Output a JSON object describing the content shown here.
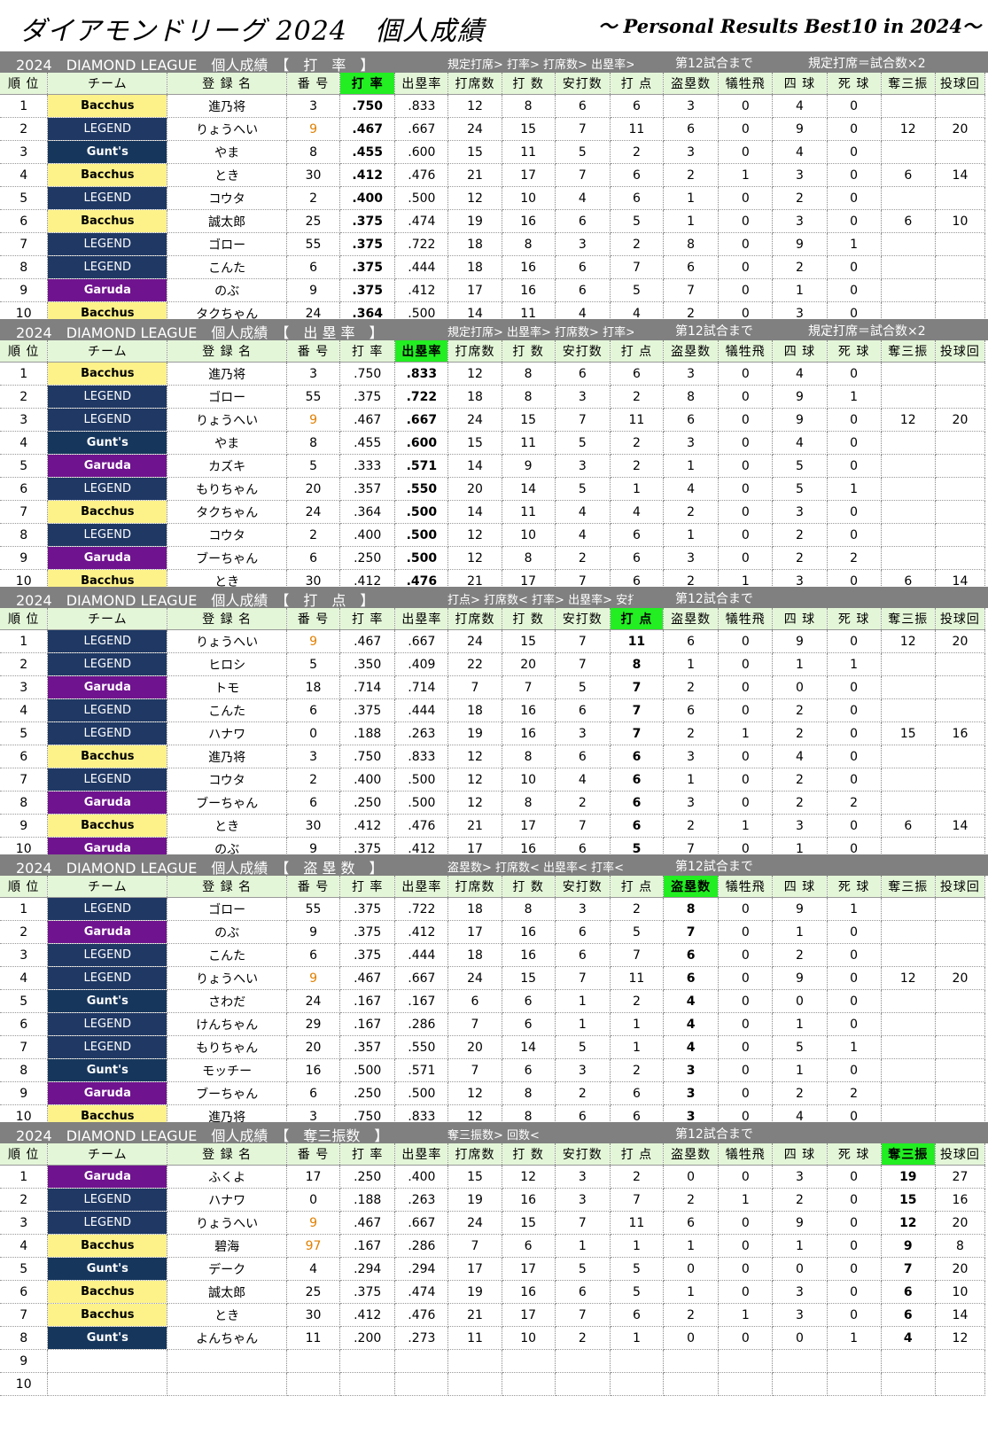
{
  "title": "ダイアモンドリーグ 2024　個人成績",
  "subtitle": "～ Personal Results Best10 in 2024～",
  "columns": [
    "順 位",
    "チーム",
    "登 録 名",
    "番 号",
    "打 率",
    "出塁率",
    "打席数",
    "打 数",
    "安打数",
    "打 点",
    "盗塁数",
    "犠牲飛",
    "四 球",
    "死 球",
    "奪三振",
    "投球回"
  ],
  "teams": {
    "B": {
      "name": "Bacchus",
      "color": "#fdf28a"
    },
    "L": {
      "name": "LEGEND",
      "color": "#1f3864"
    },
    "G": {
      "name": "Gunt's",
      "color": "#16365c"
    },
    "R": {
      "name": "Garuda",
      "color": "#70138f"
    }
  },
  "sections": [
    {
      "name": "2024　DIAMOND LEAGUE　個人成績　【　打　率　】",
      "criteria": "規定打席> 打率> 打席数> 出塁率> 打",
      "upto": "第12試合まで",
      "rule": "規定打席＝試合数×2",
      "sorted_col": 4,
      "rows": [
        [
          "1",
          "B",
          "進乃将",
          "3",
          ".750",
          ".833",
          "12",
          "8",
          "6",
          "6",
          "3",
          "0",
          "4",
          "0",
          "",
          ""
        ],
        [
          "2",
          "L",
          "りょうへい",
          "9",
          ".467",
          ".667",
          "24",
          "15",
          "7",
          "11",
          "6",
          "0",
          "9",
          "0",
          "12",
          "20"
        ],
        [
          "3",
          "G",
          "やま",
          "8",
          ".455",
          ".600",
          "15",
          "11",
          "5",
          "2",
          "3",
          "0",
          "4",
          "0",
          "",
          ""
        ],
        [
          "4",
          "B",
          "とき",
          "30",
          ".412",
          ".476",
          "21",
          "17",
          "7",
          "6",
          "2",
          "1",
          "3",
          "0",
          "6",
          "14"
        ],
        [
          "5",
          "L",
          "コウタ",
          "2",
          ".400",
          ".500",
          "12",
          "10",
          "4",
          "6",
          "1",
          "0",
          "2",
          "0",
          "",
          ""
        ],
        [
          "6",
          "B",
          "誠太郎",
          "25",
          ".375",
          ".474",
          "19",
          "16",
          "6",
          "5",
          "1",
          "0",
          "3",
          "0",
          "6",
          "10"
        ],
        [
          "7",
          "L",
          "ゴロー",
          "55",
          ".375",
          ".722",
          "18",
          "8",
          "3",
          "2",
          "8",
          "0",
          "9",
          "1",
          "",
          ""
        ],
        [
          "8",
          "L",
          "こんた",
          "6",
          ".375",
          ".444",
          "18",
          "16",
          "6",
          "7",
          "6",
          "0",
          "2",
          "0",
          "",
          ""
        ],
        [
          "9",
          "R",
          "のぶ",
          "9",
          ".375",
          ".412",
          "17",
          "16",
          "6",
          "5",
          "7",
          "0",
          "1",
          "0",
          "",
          ""
        ],
        [
          "10",
          "B",
          "タクちゃん",
          "24",
          ".364",
          ".500",
          "14",
          "11",
          "4",
          "4",
          "2",
          "0",
          "3",
          "0",
          "",
          ""
        ]
      ]
    },
    {
      "name": "2024　DIAMOND LEAGUE　個人成績　【　出 塁 率　】",
      "criteria": "規定打席> 出塁率> 打席数> 打率> 打",
      "upto": "第12試合まで",
      "rule": "規定打席＝試合数×2",
      "sorted_col": 5,
      "rows": [
        [
          "1",
          "B",
          "進乃将",
          "3",
          ".750",
          ".833",
          "12",
          "8",
          "6",
          "6",
          "3",
          "0",
          "4",
          "0",
          "",
          ""
        ],
        [
          "2",
          "L",
          "ゴロー",
          "55",
          ".375",
          ".722",
          "18",
          "8",
          "3",
          "2",
          "8",
          "0",
          "9",
          "1",
          "",
          ""
        ],
        [
          "3",
          "L",
          "りょうへい",
          "9",
          ".467",
          ".667",
          "24",
          "15",
          "7",
          "11",
          "6",
          "0",
          "9",
          "0",
          "12",
          "20"
        ],
        [
          "4",
          "G",
          "やま",
          "8",
          ".455",
          ".600",
          "15",
          "11",
          "5",
          "2",
          "3",
          "0",
          "4",
          "0",
          "",
          ""
        ],
        [
          "5",
          "R",
          "カズキ",
          "5",
          ".333",
          ".571",
          "14",
          "9",
          "3",
          "2",
          "1",
          "0",
          "5",
          "0",
          "",
          ""
        ],
        [
          "6",
          "L",
          "もりちゃん",
          "20",
          ".357",
          ".550",
          "20",
          "14",
          "5",
          "1",
          "4",
          "0",
          "5",
          "1",
          "",
          ""
        ],
        [
          "7",
          "B",
          "タクちゃん",
          "24",
          ".364",
          ".500",
          "14",
          "11",
          "4",
          "4",
          "2",
          "0",
          "3",
          "0",
          "",
          ""
        ],
        [
          "8",
          "L",
          "コウタ",
          "2",
          ".400",
          ".500",
          "12",
          "10",
          "4",
          "6",
          "1",
          "0",
          "2",
          "0",
          "",
          ""
        ],
        [
          "9",
          "R",
          "ブーちゃん",
          "6",
          ".250",
          ".500",
          "12",
          "8",
          "2",
          "6",
          "3",
          "0",
          "2",
          "2",
          "",
          ""
        ],
        [
          "10",
          "B",
          "とき",
          "30",
          ".412",
          ".476",
          "21",
          "17",
          "7",
          "6",
          "2",
          "1",
          "3",
          "0",
          "6",
          "14"
        ]
      ]
    },
    {
      "name": "2024　DIAMOND LEAGUE　個人成績　【　打　点　】",
      "criteria": "打点> 打席数< 打率> 出塁率> 安打数",
      "upto": "第12試合まで",
      "rule": "",
      "sorted_col": 9,
      "rows": [
        [
          "1",
          "L",
          "りょうへい",
          "9",
          ".467",
          ".667",
          "24",
          "15",
          "7",
          "11",
          "6",
          "0",
          "9",
          "0",
          "12",
          "20"
        ],
        [
          "2",
          "L",
          "ヒロシ",
          "5",
          ".350",
          ".409",
          "22",
          "20",
          "7",
          "8",
          "1",
          "0",
          "1",
          "1",
          "",
          ""
        ],
        [
          "3",
          "R",
          "トモ",
          "18",
          ".714",
          ".714",
          "7",
          "7",
          "5",
          "7",
          "2",
          "0",
          "0",
          "0",
          "",
          ""
        ],
        [
          "4",
          "L",
          "こんた",
          "6",
          ".375",
          ".444",
          "18",
          "16",
          "6",
          "7",
          "6",
          "0",
          "2",
          "0",
          "",
          ""
        ],
        [
          "5",
          "L",
          "ハナワ",
          "0",
          ".188",
          ".263",
          "19",
          "16",
          "3",
          "7",
          "2",
          "1",
          "2",
          "0",
          "15",
          "16"
        ],
        [
          "6",
          "B",
          "進乃将",
          "3",
          ".750",
          ".833",
          "12",
          "8",
          "6",
          "6",
          "3",
          "0",
          "4",
          "0",
          "",
          ""
        ],
        [
          "7",
          "L",
          "コウタ",
          "2",
          ".400",
          ".500",
          "12",
          "10",
          "4",
          "6",
          "1",
          "0",
          "2",
          "0",
          "",
          ""
        ],
        [
          "8",
          "R",
          "ブーちゃん",
          "6",
          ".250",
          ".500",
          "12",
          "8",
          "2",
          "6",
          "3",
          "0",
          "2",
          "2",
          "",
          ""
        ],
        [
          "9",
          "B",
          "とき",
          "30",
          ".412",
          ".476",
          "21",
          "17",
          "7",
          "6",
          "2",
          "1",
          "3",
          "0",
          "6",
          "14"
        ],
        [
          "10",
          "R",
          "のぶ",
          "9",
          ".375",
          ".412",
          "17",
          "16",
          "6",
          "5",
          "7",
          "0",
          "1",
          "0",
          "",
          ""
        ]
      ]
    },
    {
      "name": "2024　DIAMOND LEAGUE　個人成績　【　盗 塁 数　】",
      "criteria": "盗塁数> 打席数< 出塁率< 打率<",
      "upto": "第12試合まで",
      "rule": "",
      "sorted_col": 10,
      "rows": [
        [
          "1",
          "L",
          "ゴロー",
          "55",
          ".375",
          ".722",
          "18",
          "8",
          "3",
          "2",
          "8",
          "0",
          "9",
          "1",
          "",
          ""
        ],
        [
          "2",
          "R",
          "のぶ",
          "9",
          ".375",
          ".412",
          "17",
          "16",
          "6",
          "5",
          "7",
          "0",
          "1",
          "0",
          "",
          ""
        ],
        [
          "3",
          "L",
          "こんた",
          "6",
          ".375",
          ".444",
          "18",
          "16",
          "6",
          "7",
          "6",
          "0",
          "2",
          "0",
          "",
          ""
        ],
        [
          "4",
          "L",
          "りょうへい",
          "9",
          ".467",
          ".667",
          "24",
          "15",
          "7",
          "11",
          "6",
          "0",
          "9",
          "0",
          "12",
          "20"
        ],
        [
          "5",
          "G",
          "さわだ",
          "24",
          ".167",
          ".167",
          "6",
          "6",
          "1",
          "2",
          "4",
          "0",
          "0",
          "0",
          "",
          ""
        ],
        [
          "6",
          "L",
          "けんちゃん",
          "29",
          ".167",
          ".286",
          "7",
          "6",
          "1",
          "1",
          "4",
          "0",
          "1",
          "0",
          "",
          ""
        ],
        [
          "7",
          "L",
          "もりちゃん",
          "20",
          ".357",
          ".550",
          "20",
          "14",
          "5",
          "1",
          "4",
          "0",
          "5",
          "1",
          "",
          ""
        ],
        [
          "8",
          "G",
          "モッチー",
          "16",
          ".500",
          ".571",
          "7",
          "6",
          "3",
          "2",
          "3",
          "0",
          "1",
          "0",
          "",
          ""
        ],
        [
          "9",
          "R",
          "ブーちゃん",
          "6",
          ".250",
          ".500",
          "12",
          "8",
          "2",
          "6",
          "3",
          "0",
          "2",
          "2",
          "",
          ""
        ],
        [
          "10",
          "B",
          "進乃将",
          "3",
          ".750",
          ".833",
          "12",
          "8",
          "6",
          "6",
          "3",
          "0",
          "4",
          "0",
          "",
          ""
        ]
      ]
    },
    {
      "name": "2024　DIAMOND LEAGUE　個人成績　【　奪三振数　】",
      "criteria": "奪三振数> 回数<",
      "upto": "第12試合まで",
      "rule": "",
      "sorted_col": 14,
      "rows": [
        [
          "1",
          "R",
          "ふくよ",
          "17",
          ".250",
          ".400",
          "15",
          "12",
          "3",
          "2",
          "0",
          "0",
          "3",
          "0",
          "19",
          "27"
        ],
        [
          "2",
          "L",
          "ハナワ",
          "0",
          ".188",
          ".263",
          "19",
          "16",
          "3",
          "7",
          "2",
          "1",
          "2",
          "0",
          "15",
          "16"
        ],
        [
          "3",
          "L",
          "りょうへい",
          "9",
          ".467",
          ".667",
          "24",
          "15",
          "7",
          "11",
          "6",
          "0",
          "9",
          "0",
          "12",
          "20"
        ],
        [
          "4",
          "B",
          "碧海",
          "97",
          ".167",
          ".286",
          "7",
          "6",
          "1",
          "1",
          "1",
          "0",
          "1",
          "0",
          "9",
          "8"
        ],
        [
          "5",
          "G",
          "デーク",
          "4",
          ".294",
          ".294",
          "17",
          "17",
          "5",
          "5",
          "0",
          "0",
          "0",
          "0",
          "7",
          "20"
        ],
        [
          "6",
          "B",
          "誠太郎",
          "25",
          ".375",
          ".474",
          "19",
          "16",
          "6",
          "5",
          "1",
          "0",
          "3",
          "0",
          "6",
          "10"
        ],
        [
          "7",
          "B",
          "とき",
          "30",
          ".412",
          ".476",
          "21",
          "17",
          "7",
          "6",
          "2",
          "1",
          "3",
          "0",
          "6",
          "14"
        ],
        [
          "8",
          "G",
          "よんちゃん",
          "11",
          ".200",
          ".273",
          "11",
          "10",
          "2",
          "1",
          "0",
          "0",
          "0",
          "1",
          "4",
          "12"
        ],
        [
          "9",
          "",
          "",
          "",
          "",
          "",
          "",
          "",
          "",
          "",
          "",
          "",
          "",
          "",
          "",
          ""
        ],
        [
          "10",
          "",
          "",
          "",
          "",
          "",
          "",
          "",
          "",
          "",
          "",
          "",
          "",
          "",
          "",
          ""
        ]
      ]
    }
  ]
}
